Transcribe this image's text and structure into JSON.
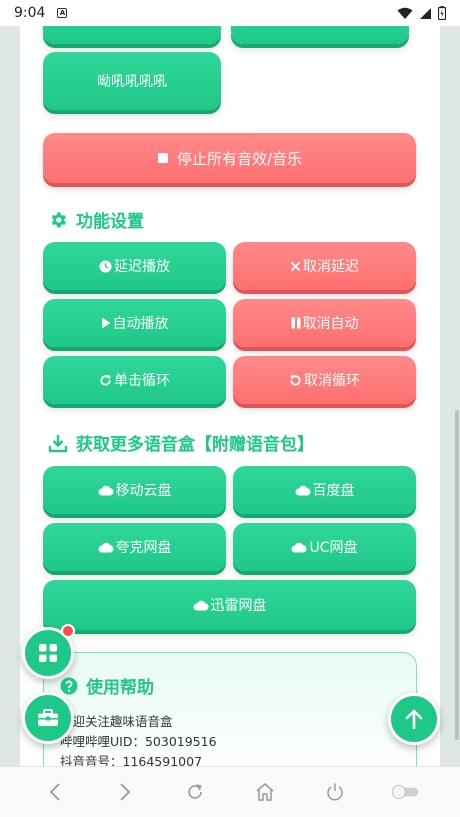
{
  "status_bar": {
    "time": "9:04",
    "notification_icon": "a-box-icon"
  },
  "top_buttons": {
    "yell_label": "呦吼吼吼吼"
  },
  "stop_all": {
    "label": "停止所有音效/音乐",
    "icon": "stop-square-icon"
  },
  "function_settings": {
    "title": "功能设置",
    "icon": "gear-icon",
    "buttons": [
      {
        "label": "延迟播放",
        "icon": "clock-icon",
        "color": "green"
      },
      {
        "label": "取消延迟",
        "icon": "close-icon",
        "color": "red"
      },
      {
        "label": "自动播放",
        "icon": "play-icon",
        "color": "green"
      },
      {
        "label": "取消自动",
        "icon": "pause-icon",
        "color": "red"
      },
      {
        "label": "单击循环",
        "icon": "redo-icon",
        "color": "green"
      },
      {
        "label": "取消循环",
        "icon": "undo-icon",
        "color": "red"
      }
    ]
  },
  "download_section": {
    "title": "获取更多语音盒【附赠语音包】",
    "icon": "download-icon",
    "buttons": [
      {
        "label": "移动云盘",
        "icon": "cloud-icon"
      },
      {
        "label": "百度盘",
        "icon": "cloud-icon"
      },
      {
        "label": "夸克网盘",
        "icon": "cloud-icon"
      },
      {
        "label": "UC网盘",
        "icon": "cloud-icon"
      },
      {
        "label": "迅雷网盘",
        "icon": "cloud-icon"
      }
    ]
  },
  "help": {
    "title": "使用帮助",
    "icon": "question-circle-icon",
    "lines": [
      "欢迎关注趣味语音盒",
      "哔哩哔哩UID：503019516",
      "抖音音号：1164591007"
    ]
  },
  "colors": {
    "accent_green": "#1fc788",
    "accent_red": "#ff6f6f"
  }
}
